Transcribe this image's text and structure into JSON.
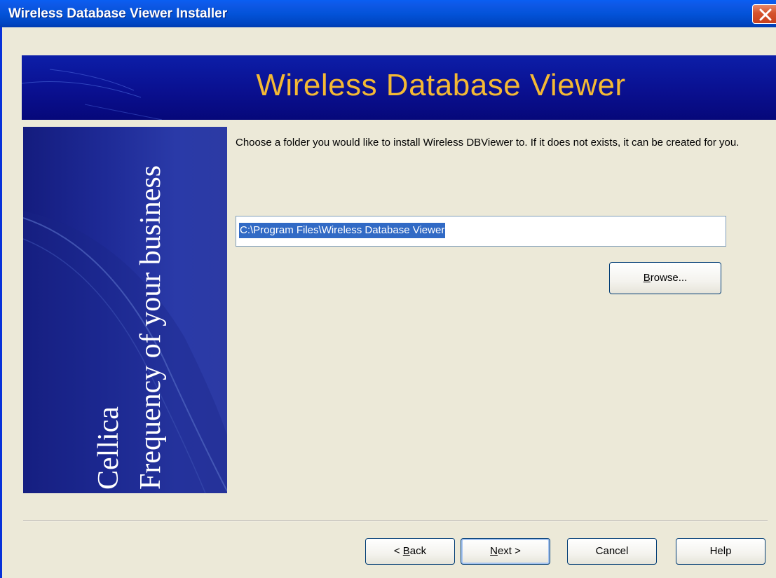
{
  "window": {
    "title": "Wireless Database Viewer Installer",
    "close_icon": "close-icon"
  },
  "banner": {
    "title": "Wireless Database Viewer"
  },
  "side_panel": {
    "brand": "Cellica",
    "tagline": "Frequency of your business"
  },
  "content": {
    "instruction": "Choose a folder you would like to install Wireless DBViewer to. If it does not exists, it can be created for you.",
    "install_path": "C:\\Program Files\\Wireless Database Viewer",
    "browse_label": {
      "prefix": "",
      "accel": "B",
      "suffix": "rowse..."
    }
  },
  "footer": {
    "back_label": {
      "prefix": "< ",
      "accel": "B",
      "suffix": "ack"
    },
    "next_label": {
      "prefix": "",
      "accel": "N",
      "suffix": "ext >"
    },
    "cancel_label": "Cancel",
    "help_label": "Help"
  },
  "colors": {
    "titlebar": "#0353d9",
    "banner": "#0a1090",
    "banner_text": "#f4b934",
    "selection": "#316ac5",
    "dialog_bg": "#ece9d8"
  }
}
